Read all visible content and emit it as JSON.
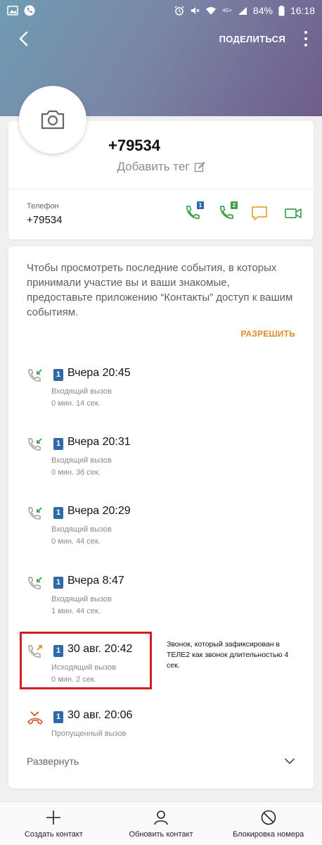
{
  "status_bar": {
    "battery": "84%",
    "time": "16:18",
    "network": "4G+"
  },
  "app_bar": {
    "share_label": "ПОДЕЛИТЬСЯ"
  },
  "contact": {
    "name": "+79534",
    "add_tag_label": "Добавить тег",
    "phone_label": "Телефон",
    "phone_number": "+79534",
    "sim1_label": "1",
    "sim2_label": "2"
  },
  "events": {
    "prompt_text": "Чтобы просмотреть последние события, в которых принимали участие вы и ваши знакомые, предоставьте приложению “Контакты” доступ к вашим событиям.",
    "allow_label": "РАЗРЕШИТЬ",
    "calls": [
      {
        "sim": "1",
        "time": "Вчера 20:45",
        "type": "Входящий вызов",
        "duration": "0 мин. 14 сек.",
        "kind": "incoming"
      },
      {
        "sim": "1",
        "time": "Вчера 20:31",
        "type": "Входящий вызов",
        "duration": "0 мин. 36 сек.",
        "kind": "incoming"
      },
      {
        "sim": "1",
        "time": "Вчера 20:29",
        "type": "Входящий вызов",
        "duration": "0 мин. 44 сек.",
        "kind": "incoming"
      },
      {
        "sim": "1",
        "time": "Вчера 8:47",
        "type": "Входящий вызов",
        "duration": "1 мин. 44 сек.",
        "kind": "incoming"
      },
      {
        "sim": "1",
        "time": "30 авг. 20:42",
        "type": "Исходящий вызов",
        "duration": "0 мин. 2 сек.",
        "kind": "outgoing"
      },
      {
        "sim": "1",
        "time": "30 авг. 20:06",
        "type": "Пропущенный вызов",
        "duration": "",
        "kind": "missed"
      }
    ],
    "expand_label": "Развернуть"
  },
  "annotation": {
    "text": "Звонок, который зафиксирован в ТЕЛЕ2 как звонок длительностью 4 сек."
  },
  "bottom_bar": {
    "create_label": "Создать контакт",
    "update_label": "Обновить контакт",
    "block_label": "Блокировка номера"
  },
  "colors": {
    "accent_orange": "#e08a2e",
    "call_green": "#3aa34a",
    "sim_blue": "#2f6aa6",
    "highlight_red": "#d11f27"
  }
}
